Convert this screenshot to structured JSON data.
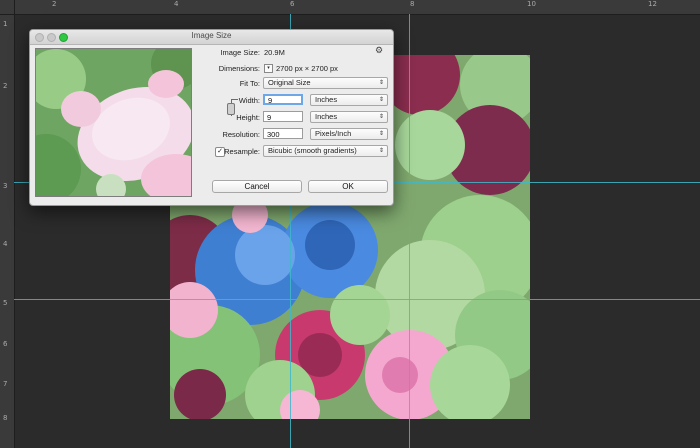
{
  "ruler": {
    "top_numbers": [
      "2",
      "4",
      "6",
      "8",
      "10",
      "12"
    ],
    "left_numbers": [
      "1",
      "2",
      "3",
      "4",
      "5",
      "6",
      "7",
      "8"
    ]
  },
  "dialog": {
    "title": "Image Size",
    "image_size_label": "Image Size:",
    "image_size_value": "20.9M",
    "dimensions_label": "Dimensions:",
    "dimensions_value": "2700 px  ×  2700 px",
    "fit_to_label": "Fit To:",
    "fit_to_value": "Original Size",
    "width_label": "Width:",
    "width_value": "9",
    "width_unit": "Inches",
    "height_label": "Height:",
    "height_value": "9",
    "height_unit": "Inches",
    "resolution_label": "Resolution:",
    "resolution_value": "300",
    "resolution_unit": "Pixels/Inch",
    "resample_label": "Resample:",
    "resample_checked": "✓",
    "resample_value": "Bicubic (smooth gradients)",
    "cancel_label": "Cancel",
    "ok_label": "OK"
  },
  "colors": {
    "guide": "#3fb8c9",
    "canvas_bg": "#2b2b2b",
    "dialog_bg": "#ececec"
  }
}
